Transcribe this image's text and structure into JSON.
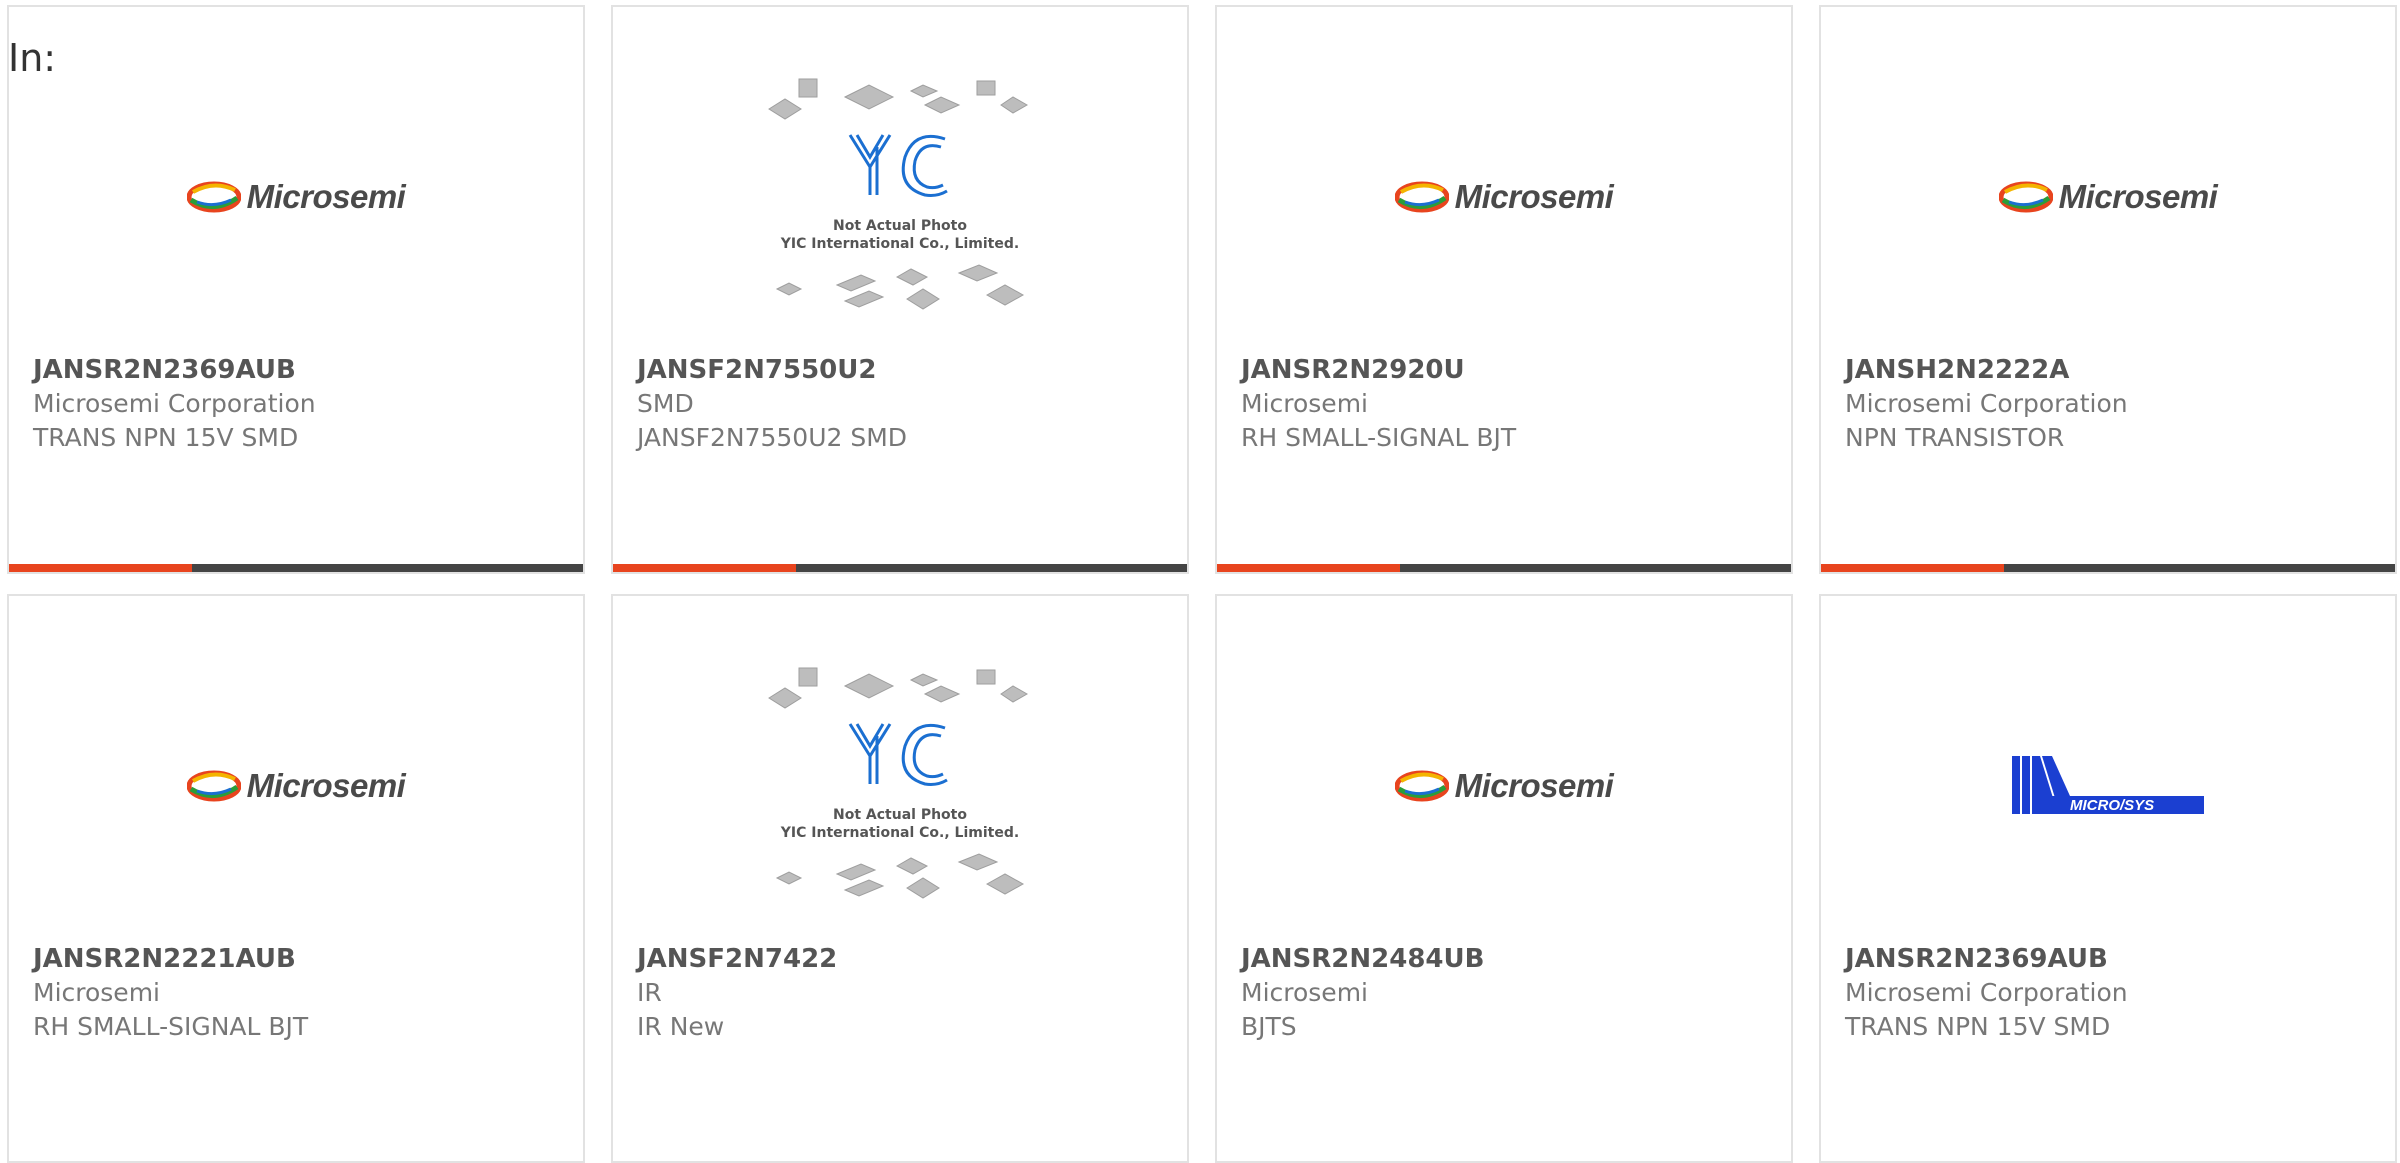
{
  "header": {
    "in_label": "In:"
  },
  "colors": {
    "accent": "#e8441e",
    "bar": "#444444",
    "border": "#e2e2e2",
    "microsys_blue": "#1b3fd1"
  },
  "placeholder": {
    "line1": "Not Actual Photo",
    "line2": "YIC International Co., Limited."
  },
  "logos": {
    "microsemi": "Microsemi",
    "microsys": "MICRO/SYS"
  },
  "products": [
    {
      "part": "JANSR2N2369AUB",
      "manufacturer": "Microsemi Corporation",
      "description": "TRANS NPN 15V SMD",
      "logo": "microsemi"
    },
    {
      "part": "JANSF2N7550U2",
      "manufacturer": "SMD",
      "description": "JANSF2N7550U2 SMD",
      "logo": "yic-placeholder"
    },
    {
      "part": "JANSR2N2920U",
      "manufacturer": "Microsemi",
      "description": "RH SMALL-SIGNAL BJT",
      "logo": "microsemi"
    },
    {
      "part": "JANSH2N2222A",
      "manufacturer": "Microsemi Corporation",
      "description": "NPN TRANSISTOR",
      "logo": "microsemi"
    },
    {
      "part": "JANSR2N2221AUB",
      "manufacturer": "Microsemi",
      "description": "RH SMALL-SIGNAL BJT",
      "logo": "microsemi"
    },
    {
      "part": "JANSF2N7422",
      "manufacturer": "IR",
      "description": "IR New",
      "logo": "yic-placeholder"
    },
    {
      "part": "JANSR2N2484UB",
      "manufacturer": "Microsemi",
      "description": "BJTS",
      "logo": "microsemi"
    },
    {
      "part": "JANSR2N2369AUB",
      "manufacturer": "Microsemi Corporation",
      "description": "TRANS NPN 15V SMD",
      "logo": "microsys"
    }
  ]
}
